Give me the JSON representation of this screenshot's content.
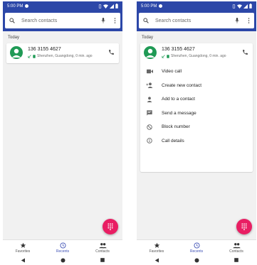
{
  "screens": [
    {
      "status": {
        "time": "5:00 PM"
      },
      "search": {
        "placeholder": "Search contacts"
      },
      "section": "Today",
      "call": {
        "number": "136 3155 4627",
        "detail": "Shenzhen, Guangdong, 0 min. ago"
      },
      "nav": {
        "favorites": "Favorites",
        "recents": "Recents",
        "contacts": "Contacts"
      }
    },
    {
      "status": {
        "time": "5:00 PM"
      },
      "search": {
        "placeholder": "Search contacts"
      },
      "section": "Today",
      "call": {
        "number": "136 3155 4627",
        "detail": "Shenzhen, Guangdong, 0 min. ago"
      },
      "menu": {
        "items": [
          {
            "label": "Video call",
            "icon": "video-icon"
          },
          {
            "label": "Create new contact",
            "icon": "add-person-icon"
          },
          {
            "label": "Add to a contact",
            "icon": "person-icon"
          },
          {
            "label": "Send a message",
            "icon": "message-icon"
          },
          {
            "label": "Block number",
            "icon": "block-icon"
          },
          {
            "label": "Call details",
            "icon": "info-icon"
          }
        ]
      },
      "nav": {
        "favorites": "Favorites",
        "recents": "Recents",
        "contacts": "Contacts"
      }
    }
  ],
  "colors": {
    "header": "#2c47a8",
    "fab": "#e91e63",
    "avatar": "#1f9a55",
    "active_tab": "#3f51b5"
  }
}
